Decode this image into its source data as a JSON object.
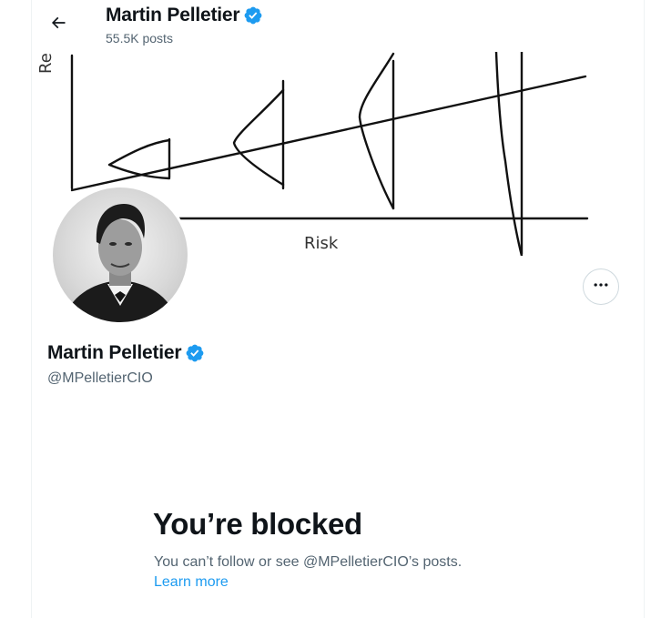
{
  "header": {
    "name": "Martin Pelletier",
    "posts_count": "55.5K posts"
  },
  "banner": {
    "x_axis_label": "Risk",
    "y_axis_label_fragment": "Re"
  },
  "profile": {
    "name": "Martin Pelletier",
    "handle": "@MPelletierCIO"
  },
  "blocked": {
    "title": "You’re blocked",
    "description": "You can’t follow or see @MPelletierCIO’s posts.",
    "learn_more": "Learn more"
  },
  "icons": {
    "back": "back-arrow-icon",
    "verified": "verified-badge-icon",
    "more": "more-horizontal-icon"
  },
  "colors": {
    "verified": "#1d9bf0",
    "link": "#1d9bf0",
    "secondary_text": "#536471"
  }
}
